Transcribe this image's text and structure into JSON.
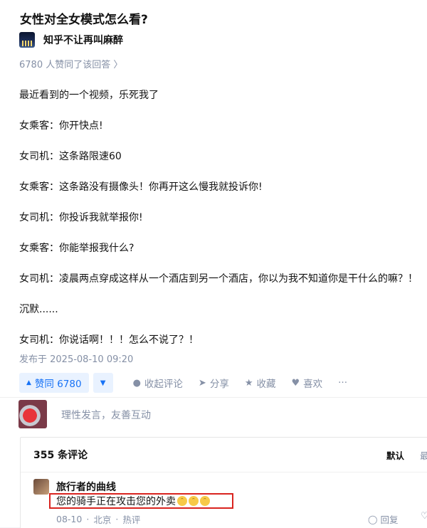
{
  "question": {
    "title": "女性对全女模式怎么看?"
  },
  "author": {
    "name": "知乎不让再叫麻醉"
  },
  "answer": {
    "upvote_summary": "6780 人赞同了该回答 〉",
    "paragraphs": [
      "最近看到的一个视频，乐死我了",
      "女乘客：你开快点!",
      "女司机：这条路限速60",
      "女乘客：这条路没有摄像头！你再开这么慢我就投诉你!",
      "女司机：你投诉我就举报你!",
      "女乘客：你能举报我什么?",
      "女司机：凌晨两点穿成这样从一个酒店到另一个酒店，你以为我不知道你是干什么的嘛？！",
      "沉默......",
      "女司机：你说话啊！！！怎么不说了？！"
    ],
    "publish_time": "发布于 2025-08-10 09:20"
  },
  "actions": {
    "upvote_label": "赞同 6780",
    "comment_label": "收起评论",
    "share_label": "分享",
    "favorite_label": "收藏",
    "like_label": "喜欢",
    "more_label": "···"
  },
  "comment_input": {
    "placeholder": "理性发言，友善互动"
  },
  "comments": {
    "count_label": "355 条评论",
    "sort_default": "默认",
    "sort_latest": "最",
    "items": [
      {
        "author": "旅行者的曲线",
        "text": "您的骑手正在攻击您的外卖",
        "emoji_count": 3,
        "date": "08-10",
        "location": "北京",
        "tag": "热评",
        "reply_label": "回复"
      }
    ]
  },
  "colors": {
    "accent": "#1772f6",
    "accent_bg": "#e9f2ff",
    "muted": "#8590a6",
    "highlight": "#d9241f"
  }
}
